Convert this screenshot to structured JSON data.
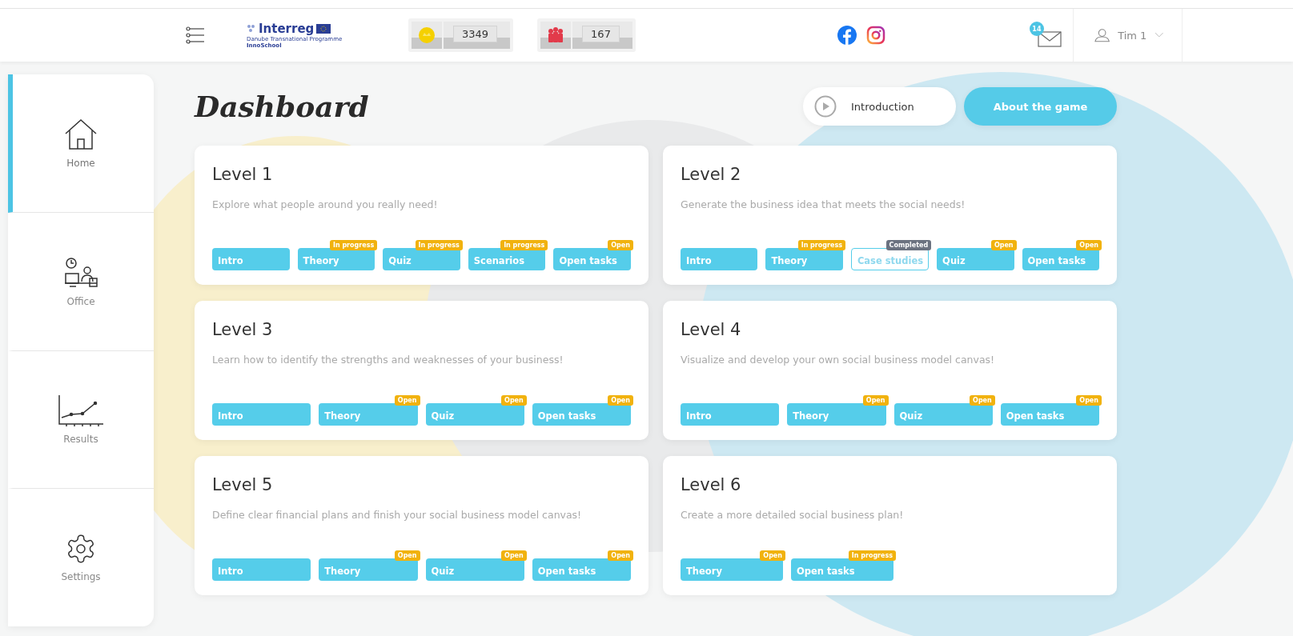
{
  "header": {
    "logo": {
      "title": "Interreg",
      "subtitle": "Danube Transnational Programme",
      "project": "InnoSchool"
    },
    "counters": [
      {
        "kind": "coin",
        "value": "3349"
      },
      {
        "kind": "team",
        "value": "167"
      }
    ],
    "messages_badge": "14",
    "user": "Tim 1"
  },
  "sidebar": {
    "items": [
      {
        "kind": "home",
        "label": "Home",
        "selected": true
      },
      {
        "kind": "office",
        "label": "Office",
        "selected": false
      },
      {
        "kind": "results",
        "label": "Results",
        "selected": false
      },
      {
        "kind": "settings",
        "label": "Settings",
        "selected": false
      }
    ]
  },
  "title": "Dashboard",
  "actions": [
    {
      "kind": "secondary",
      "label": "Introduction"
    },
    {
      "kind": "primary",
      "label": "About the game"
    }
  ],
  "levels": [
    {
      "title": "Level 1",
      "description": "Explore what people around you really need!",
      "tasks": [
        {
          "label": "Intro",
          "completed": false
        },
        {
          "label": "Theory",
          "badge": "In progress",
          "completed": false
        },
        {
          "label": "Quiz",
          "badge": "In progress",
          "completed": false
        },
        {
          "label": "Scenarios",
          "badge": "In progress",
          "completed": false
        },
        {
          "label": "Open tasks",
          "badge": "Open",
          "completed": false
        }
      ]
    },
    {
      "title": "Level 2",
      "description": "Generate the business idea that meets the social needs!",
      "tasks": [
        {
          "label": "Intro",
          "completed": false
        },
        {
          "label": "Theory",
          "badge": "In progress",
          "completed": false
        },
        {
          "label": "Case studies",
          "badge": "Completed",
          "completed": true
        },
        {
          "label": "Quiz",
          "badge": "Open",
          "completed": false
        },
        {
          "label": "Open tasks",
          "badge": "Open",
          "completed": false
        }
      ]
    },
    {
      "title": "Level 3",
      "description": "Learn how to identify the strengths and weaknesses of your business!",
      "tasks": [
        {
          "label": "Intro",
          "completed": false
        },
        {
          "label": "Theory",
          "badge": "Open",
          "completed": false
        },
        {
          "label": "Quiz",
          "badge": "Open",
          "completed": false
        },
        {
          "label": "Open tasks",
          "badge": "Open",
          "completed": false
        }
      ]
    },
    {
      "title": "Level 4",
      "description": "Visualize and develop your own social business model canvas!",
      "tasks": [
        {
          "label": "Intro",
          "completed": false
        },
        {
          "label": "Theory",
          "badge": "Open",
          "completed": false
        },
        {
          "label": "Quiz",
          "badge": "Open",
          "completed": false
        },
        {
          "label": "Open tasks",
          "badge": "Open",
          "completed": false
        }
      ]
    },
    {
      "title": "Level 5",
      "description": "Define clear financial plans and finish your social business model canvas!",
      "tasks": [
        {
          "label": "Intro",
          "completed": false
        },
        {
          "label": "Theory",
          "badge": "Open",
          "completed": false
        },
        {
          "label": "Quiz",
          "badge": "Open",
          "completed": false
        },
        {
          "label": "Open tasks",
          "badge": "Open",
          "completed": false
        }
      ]
    },
    {
      "title": "Level 6",
      "description": "Create a more detailed social business plan!",
      "tasks": [
        {
          "label": "Theory",
          "badge": "Open",
          "completed": false
        },
        {
          "label": "Open tasks",
          "badge": "In progress",
          "completed": false
        }
      ]
    }
  ]
}
